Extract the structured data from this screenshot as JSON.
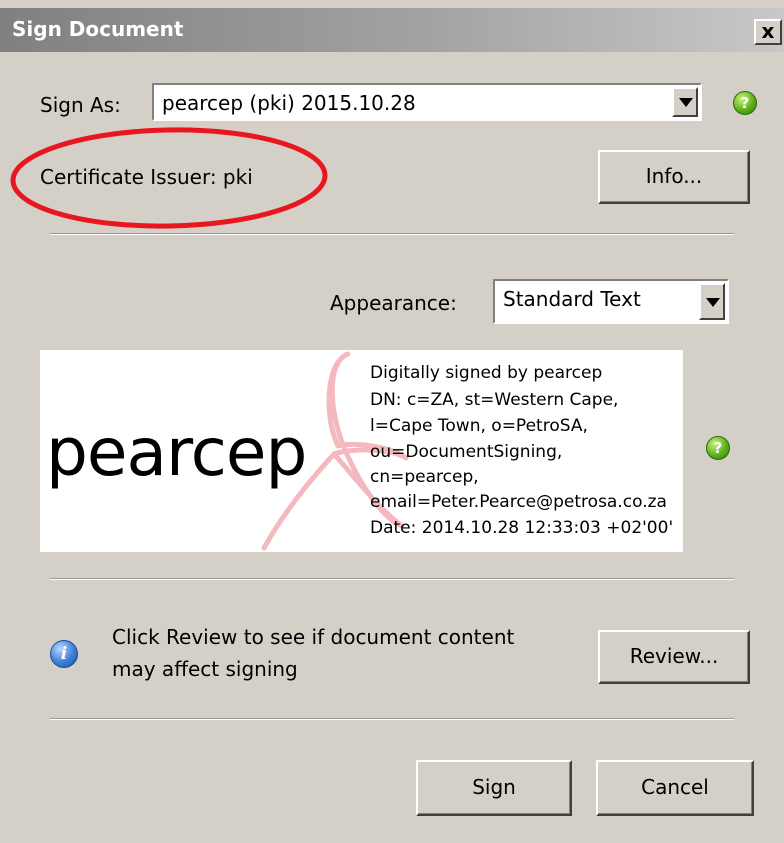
{
  "window": {
    "title": "Sign Document",
    "close_label": "x"
  },
  "sign_as": {
    "label": "Sign As:",
    "value": "pearcep (pki) 2015.10.28"
  },
  "certificate": {
    "issuer_text": "Certificate Issuer: pki",
    "info_button": "Info..."
  },
  "appearance": {
    "label": "Appearance:",
    "value": "Standard Text"
  },
  "signature_preview": {
    "name": "pearcep",
    "details": [
      "Digitally signed by pearcep",
      "DN: c=ZA, st=Western Cape,",
      "l=Cape Town, o=PetroSA,",
      "ou=DocumentSigning,",
      "cn=pearcep,",
      "email=Peter.Pearce@petrosa.co.za",
      "Date: 2014.10.28 12:33:03 +02'00'"
    ]
  },
  "review": {
    "message_line1": "Click Review to see if document content",
    "message_line2": "may affect signing",
    "button": "Review..."
  },
  "actions": {
    "sign": "Sign",
    "cancel": "Cancel"
  },
  "icons": {
    "help": "help-icon",
    "info": "info-icon",
    "dropdown": "chevron-down-icon",
    "close": "close-icon"
  },
  "colors": {
    "dialog_bg": "#d4d0c8",
    "highlight_ellipse": "#e8161e",
    "help_icon": "#5fb01c",
    "info_icon": "#3d7fd6"
  }
}
